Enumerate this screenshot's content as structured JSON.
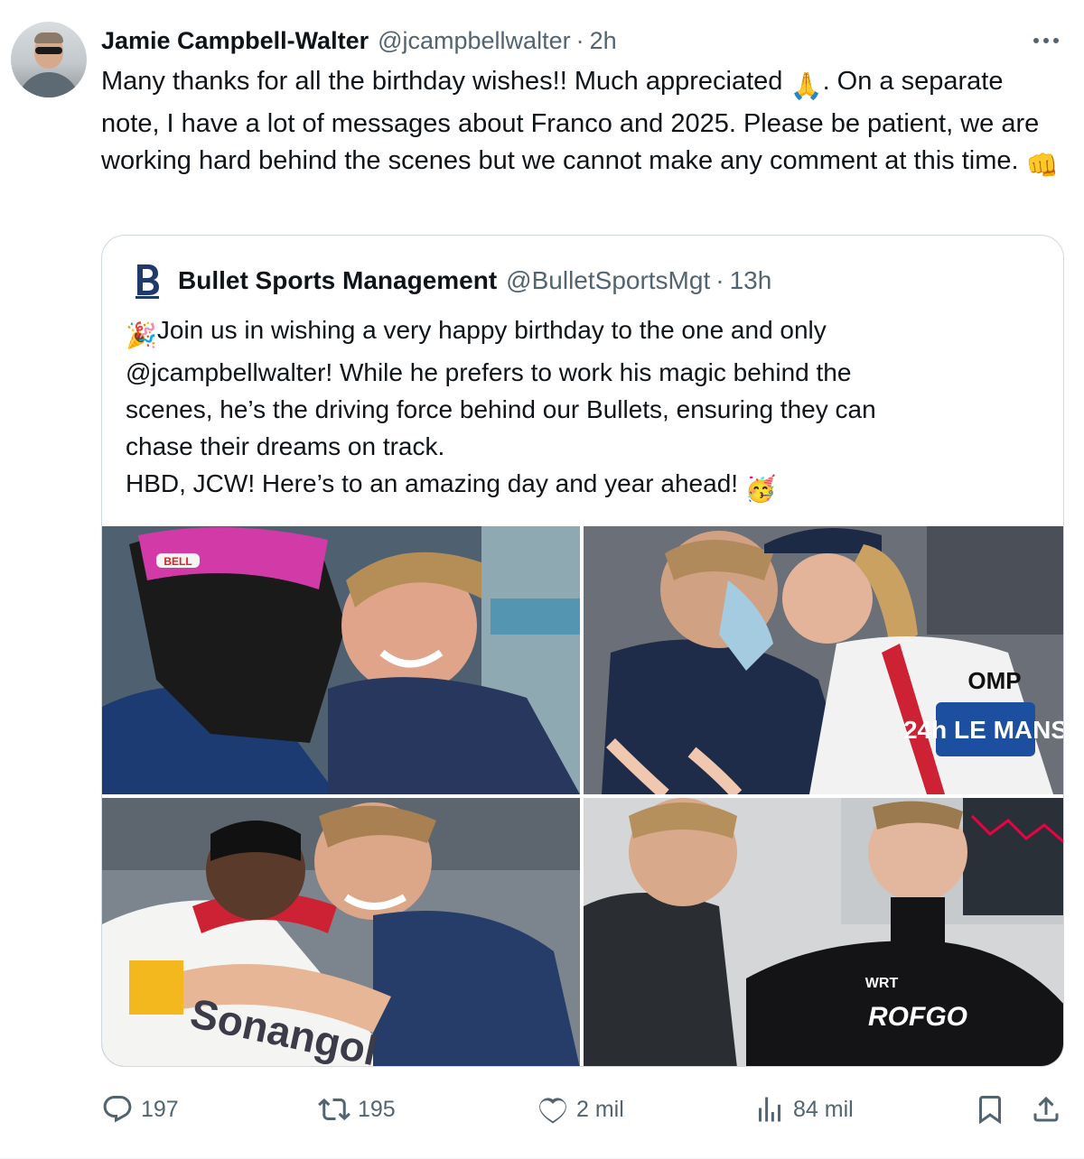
{
  "tweet": {
    "author_name": "Jamie Campbell-Walter",
    "author_handle": "@jcampbellwalter",
    "separator": "·",
    "time": "2h",
    "text_part1": "Many thanks for all the birthday wishes!! Much appreciated ",
    "emoji_pray": "🙏",
    "text_part2": ". On a separate note, I have a lot of messages about Franco and 2025. Please be patient, we are working hard behind the scenes but we cannot make any comment at this time. ",
    "emoji_fist": "👊"
  },
  "quote": {
    "author_name": "Bullet Sports Management",
    "author_handle": "@BulletSportsMgt",
    "separator": "·",
    "time": "13h",
    "emoji_party": "🎉",
    "line1": "Join us in wishing a very happy birthday to the one and only",
    "line2": "@jcampbellwalter! While he prefers to work his magic behind the",
    "line3": "scenes, he’s the driving force behind our Bullets, ensuring they can",
    "line4": "chase their dreams on track.",
    "line5": "HBD, JCW! Here’s to an amazing day and year ahead!",
    "emoji_celebrate": "🥳",
    "photo_texts": {
      "helmet_brand": "BELL",
      "shirt_brand": "OMP",
      "le_mans": "24h LE MANS",
      "sponsor": "Sonangol",
      "team": "WRT",
      "sponsor2": "ROFGO"
    }
  },
  "actions": {
    "replies": "197",
    "reposts": "195",
    "likes": "2 mil",
    "views": "84 mil"
  },
  "colors": {
    "text": "#0f1419",
    "secondary": "#536471",
    "border": "#cfd9de"
  },
  "icons": [
    "more-icon",
    "reply-icon",
    "repost-icon",
    "like-icon",
    "views-icon",
    "bookmark-icon",
    "share-icon"
  ]
}
